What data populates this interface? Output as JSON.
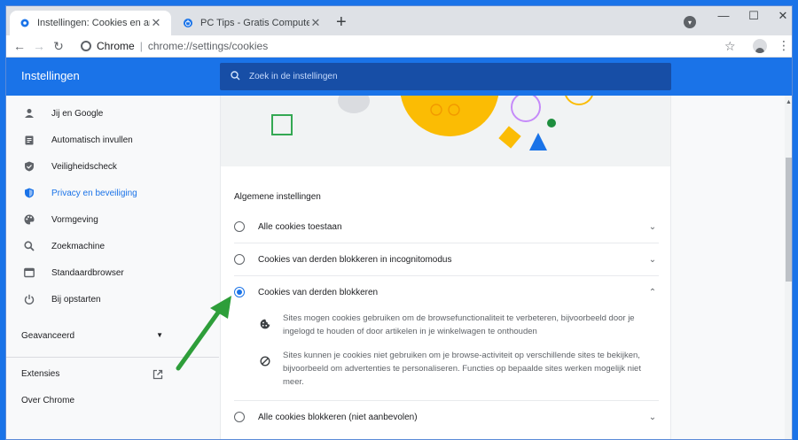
{
  "browser": {
    "tabs": [
      {
        "title": "Instellingen: Cookies en andere s",
        "active": true
      },
      {
        "title": "PC Tips - Gratis Computer Tips, s",
        "active": false
      }
    ],
    "omnibox": {
      "origin": "Chrome",
      "path": "chrome://settings/cookies"
    }
  },
  "header": {
    "title": "Instellingen",
    "search_placeholder": "Zoek in de instellingen"
  },
  "sidebar": {
    "items": [
      {
        "label": "Jij en Google",
        "icon": "person-icon"
      },
      {
        "label": "Automatisch invullen",
        "icon": "clipboard-icon"
      },
      {
        "label": "Veiligheidscheck",
        "icon": "shield-check-icon"
      },
      {
        "label": "Privacy en beveiliging",
        "icon": "shield-icon",
        "active": true
      },
      {
        "label": "Vormgeving",
        "icon": "palette-icon"
      },
      {
        "label": "Zoekmachine",
        "icon": "search-icon"
      },
      {
        "label": "Standaardbrowser",
        "icon": "browser-icon"
      },
      {
        "label": "Bij opstarten",
        "icon": "power-icon"
      }
    ],
    "advanced": "Geavanceerd",
    "extensions": "Extensies",
    "about": "Over Chrome"
  },
  "main": {
    "section_title": "Algemene instellingen",
    "options": [
      {
        "label": "Alle cookies toestaan",
        "checked": false
      },
      {
        "label": "Cookies van derden blokkeren in incognitomodus",
        "checked": false
      },
      {
        "label": "Cookies van derden blokkeren",
        "checked": true
      },
      {
        "label": "Alle cookies blokkeren (niet aanbevolen)",
        "checked": false
      }
    ],
    "details": [
      {
        "icon": "cookie-icon",
        "text": "Sites mogen cookies gebruiken om de browsefunctionaliteit te verbeteren, bijvoorbeeld door je ingelogd te houden of door artikelen in je winkelwagen te onthouden"
      },
      {
        "icon": "block-icon",
        "text": "Sites kunnen je cookies niet gebruiken om je browse-activiteit op verschillende sites te bekijken, bijvoorbeeld om advertenties te personaliseren. Functies op bepaalde sites werken mogelijk niet meer."
      }
    ]
  },
  "colors": {
    "accent": "#1a73e8",
    "header_search_bg": "#174ea6",
    "annotation_arrow": "#2e9e3a"
  }
}
